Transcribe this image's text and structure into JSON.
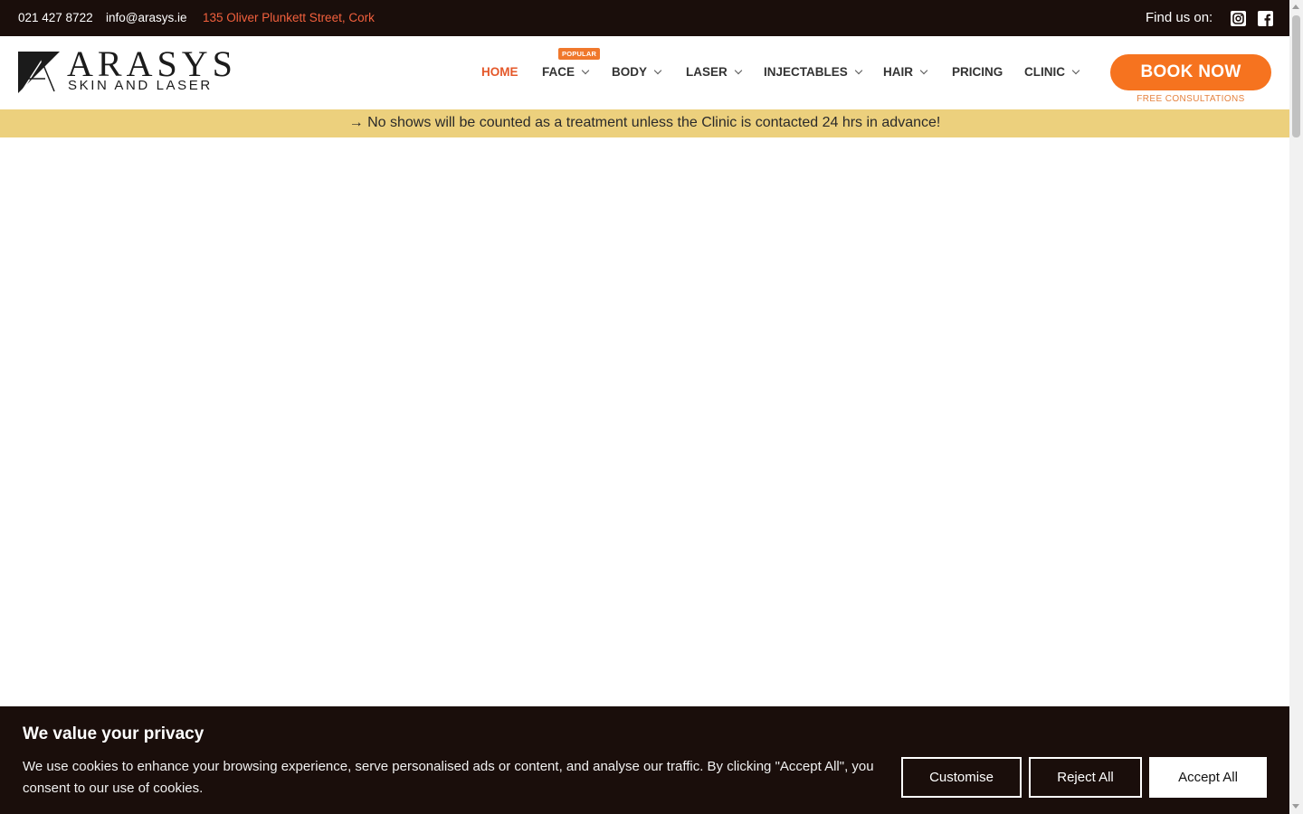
{
  "topbar": {
    "phone": "021 427 8722",
    "email": "info@arasys.ie",
    "address": "135 Oliver Plunkett Street, Cork",
    "find_us": "Find us on:",
    "social_icons": [
      "instagram-icon",
      "facebook-icon"
    ]
  },
  "logo": {
    "word": "ARASYS",
    "sub": "SKIN AND LASER"
  },
  "nav": {
    "items": [
      {
        "label": "HOME",
        "active": true,
        "dropdown": false
      },
      {
        "label": "FACE",
        "active": false,
        "dropdown": true,
        "badge": "POPULAR"
      },
      {
        "label": "BODY",
        "active": false,
        "dropdown": true
      },
      {
        "label": "LASER",
        "active": false,
        "dropdown": true
      },
      {
        "label": "INJECTABLES",
        "active": false,
        "dropdown": true
      },
      {
        "label": "HAIR",
        "active": false,
        "dropdown": true
      },
      {
        "label": "PRICING",
        "active": false,
        "dropdown": false
      },
      {
        "label": "CLINIC",
        "active": false,
        "dropdown": true
      }
    ]
  },
  "cta": {
    "book_label": "BOOK NOW",
    "sub_label": "FREE CONSULTATIONS"
  },
  "notice": {
    "text": "→ No shows will be counted as a treatment unless the Clinic is contacted 24 hrs in advance!"
  },
  "cookie": {
    "title": "We value your privacy",
    "text": "We use cookies to enhance your browsing experience, serve personalised ads or content, and analyse our traffic. By clicking \"Accept All\", you consent to our use of cookies.",
    "customise_label": "Customise",
    "reject_label": "Reject All",
    "accept_label": "Accept All"
  },
  "colors": {
    "accent": "#e4582a",
    "button": "#f6731f",
    "topbar_bg": "#1a0e0b",
    "notice_bg": "#ecd07d"
  }
}
